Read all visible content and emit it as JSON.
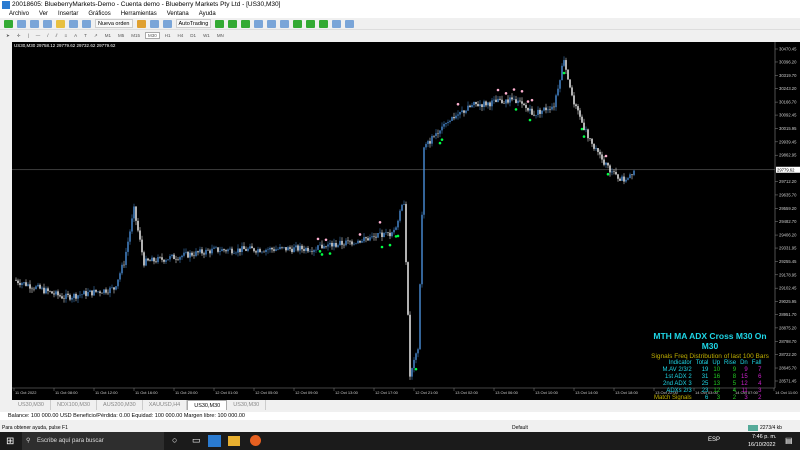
{
  "window": {
    "title": "20018605: BlueberryMarkets-Demo - Cuenta demo - Blueberry Markets Pty Ltd - [US30,M30]"
  },
  "menu": [
    "Archivo",
    "Ver",
    "Insertar",
    "Gráficos",
    "Herramientas",
    "Ventana",
    "Ayuda"
  ],
  "toolbar": {
    "new_order": "Nueva orden",
    "autotrading": "AutoTrading"
  },
  "timeframes": [
    "M1",
    "M5",
    "M15",
    "M30",
    "H1",
    "H4",
    "D1",
    "W1",
    "MN"
  ],
  "chart": {
    "info": "US30,M30  29758.12 29779.62 29732.62 29779.62",
    "current_price": "29779.62",
    "price_range": [
      28571.45,
      30470.45
    ],
    "price_ticks": [
      "30470.45",
      "30396.20",
      "30319.70",
      "30243.20",
      "30166.70",
      "30092.45",
      "30015.95",
      "29939.45",
      "29862.95",
      "29712.20",
      "29635.70",
      "29559.20",
      "29482.70",
      "29406.20",
      "29331.95",
      "29255.45",
      "29178.95",
      "29102.45",
      "29025.95",
      "28951.70",
      "28875.20",
      "28798.70",
      "28722.20",
      "28645.70",
      "28571.45"
    ],
    "time_ticks": [
      "11 Oct 2022",
      "11 Oct 08:00",
      "11 Oct 12:00",
      "11 Oct 16:00",
      "11 Oct 20:00",
      "12 Oct 01:00",
      "12 Oct 05:00",
      "12 Oct 09:00",
      "12 Oct 13:00",
      "12 Oct 17:00",
      "12 Oct 21:00",
      "13 Oct 02:00",
      "13 Oct 06:00",
      "13 Oct 10:00",
      "13 Oct 14:00",
      "13 Oct 18:00",
      "13 Oct 22:00",
      "14 Oct 03:00",
      "14 Oct 07:00",
      "14 Oct 11:00",
      "14 Oct 15:00",
      "14 Oct 19:00",
      "14 Oct 23:00"
    ],
    "price_path": [
      [
        0,
        29150
      ],
      [
        25,
        29050
      ],
      [
        50,
        29100
      ],
      [
        55,
        29250
      ],
      [
        60,
        29550
      ],
      [
        65,
        29250
      ],
      [
        100,
        29320
      ],
      [
        150,
        29330
      ],
      [
        175,
        29380
      ],
      [
        190,
        29420
      ],
      [
        195,
        29600
      ],
      [
        198,
        28600
      ],
      [
        202,
        28750
      ],
      [
        205,
        29900
      ],
      [
        215,
        30050
      ],
      [
        230,
        30150
      ],
      [
        250,
        30180
      ],
      [
        260,
        30100
      ],
      [
        270,
        30150
      ],
      [
        275,
        30420
      ],
      [
        280,
        30150
      ],
      [
        290,
        29900
      ],
      [
        300,
        29750
      ],
      [
        305,
        29720
      ],
      [
        310,
        29780
      ]
    ],
    "colors": {
      "bull": "#4a8fd9",
      "bear": "#ffffff",
      "buy_signal": "#00ff44",
      "sell_signal": "#ff8800"
    }
  },
  "stats": {
    "title": "MTH MA ADX Cross M30 On M30",
    "subtitle": "Signals Freq Distribution of last 100 Bars",
    "headers": [
      "Indicator",
      "Total",
      "Up",
      "Rise",
      "Dn",
      "Fall"
    ],
    "rows": [
      [
        "M.AV 2/3/2",
        "19",
        "10",
        "9",
        "9",
        "7"
      ],
      [
        "1st ADX 2",
        "31",
        "16",
        "8",
        "15",
        "6"
      ],
      [
        "2nd ADX 3",
        "25",
        "13",
        "5",
        "12",
        "4"
      ],
      [
        "ADXs 2/3",
        "23",
        "12",
        "4",
        "11",
        "3"
      ],
      [
        "Match Signals",
        "6",
        "3",
        "2",
        "3",
        "2"
      ]
    ]
  },
  "tabs": [
    "US30,M30",
    "NDX100,M30",
    "AUS200,M30",
    "XAUUSD,H4",
    "US30,M30",
    "US30,M30"
  ],
  "active_tab": 4,
  "balance": "Balance: 100 000.00 USD  Beneficio/Pérdida: 0.00  Equidad: 100 000.00  Margen libre: 100 000.00",
  "status": {
    "help": "Para obtener ayuda, pulse F1",
    "profile": "Default",
    "traffic": "2273/4 kb"
  },
  "taskbar": {
    "search_placeholder": "Escribe aquí para buscar",
    "lang": "ESP",
    "time": "7:46 p. m.",
    "date": "16/10/2022"
  }
}
